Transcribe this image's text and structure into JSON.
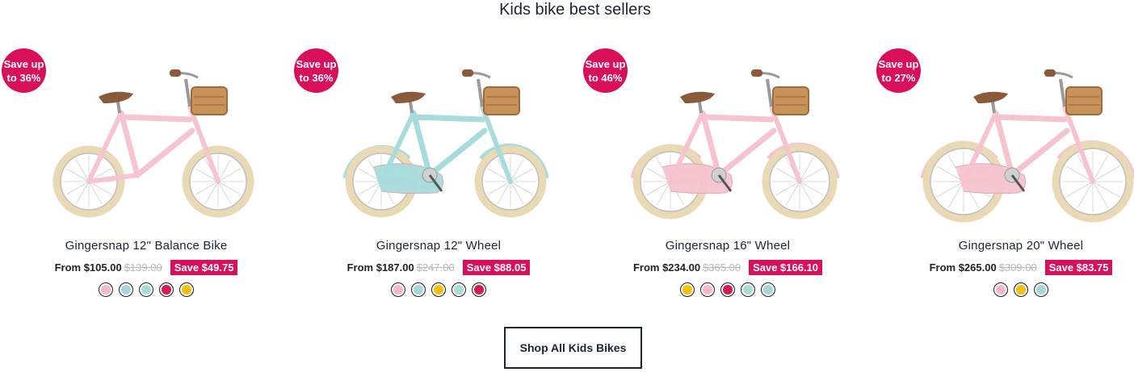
{
  "section_title": "Kids bike best sellers",
  "products": [
    {
      "name": "Gingersnap 12\" Balance Bike",
      "badge_line1": "Save up",
      "badge_line2": "to 36%",
      "from_price": "From $105.00",
      "old_price": "$139.00",
      "save": "Save $49.75",
      "frame_color": "#f5c6d0",
      "swatches": [
        "#f7b8c8",
        "#a9d4dc",
        "#a8ddd6",
        "#d21c4f",
        "#f4c20d"
      ]
    },
    {
      "name": "Gingersnap 12\" Wheel",
      "badge_line1": "Save up",
      "badge_line2": "to 36%",
      "from_price": "From $187.00",
      "old_price": "$247.00",
      "save": "Save $88.05",
      "frame_color": "#a8dcdc",
      "swatches": [
        "#f7b8c8",
        "#a9d4dc",
        "#f4c20d",
        "#a8ddd6",
        "#d21c4f"
      ]
    },
    {
      "name": "Gingersnap 16\" Wheel",
      "badge_line1": "Save up",
      "badge_line2": "to 46%",
      "from_price": "From $234.00",
      "old_price": "$365.00",
      "save": "Save $166.10",
      "frame_color": "#f6c4cf",
      "swatches": [
        "#f4c20d",
        "#f7b8c8",
        "#d21c4f",
        "#a8ddd6",
        "#a9d4dc"
      ]
    },
    {
      "name": "Gingersnap 20\" Wheel",
      "badge_line1": "Save up",
      "badge_line2": "to 27%",
      "from_price": "From $265.00",
      "old_price": "$309.00",
      "save": "Save $83.75",
      "frame_color": "#f6c4cf",
      "swatches": [
        "#f7b8c8",
        "#f4c20d",
        "#a9d4dc"
      ]
    }
  ],
  "cta_label": "Shop All Kids Bikes",
  "colors": {
    "accent": "#d90f5b",
    "text": "#1c2536",
    "tyre": "#e9d9b4",
    "saddle": "#8a5a3a",
    "basket": "#c8935a"
  }
}
